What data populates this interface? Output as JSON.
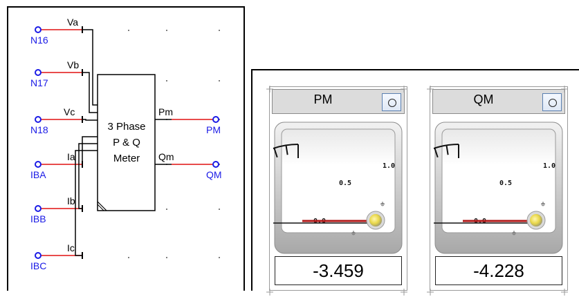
{
  "schematic": {
    "input_nodes": [
      {
        "node": "N16",
        "signal": "Va"
      },
      {
        "node": "N17",
        "signal": "Vb"
      },
      {
        "node": "N18",
        "signal": "Vc"
      },
      {
        "node": "IBA",
        "signal": "Ia"
      },
      {
        "node": "IBB",
        "signal": "Ib"
      },
      {
        "node": "IBC",
        "signal": "Ic"
      }
    ],
    "block": {
      "line1": "3 Phase",
      "line2": "P & Q",
      "line3": "Meter"
    },
    "outputs": [
      {
        "signal": "Pm",
        "node": "PM"
      },
      {
        "signal": "Qm",
        "node": "QM"
      }
    ]
  },
  "meters": [
    {
      "title": "PM",
      "value": "-3.459",
      "scale": {
        "min": 0.0,
        "mid": 0.5,
        "max": 1.0,
        "labels": [
          "0.0",
          "0.5",
          "1.0"
        ]
      }
    },
    {
      "title": "QM",
      "value": "-4.228",
      "scale": {
        "min": 0.0,
        "mid": 0.5,
        "max": 1.0,
        "labels": [
          "0.0",
          "0.5",
          "1.0"
        ]
      }
    }
  ],
  "colors": {
    "wire": "#000000",
    "node_wire": "#e01010",
    "node": "#1a1ae6",
    "needle": "#b01818",
    "grid_dot": "#555555"
  }
}
